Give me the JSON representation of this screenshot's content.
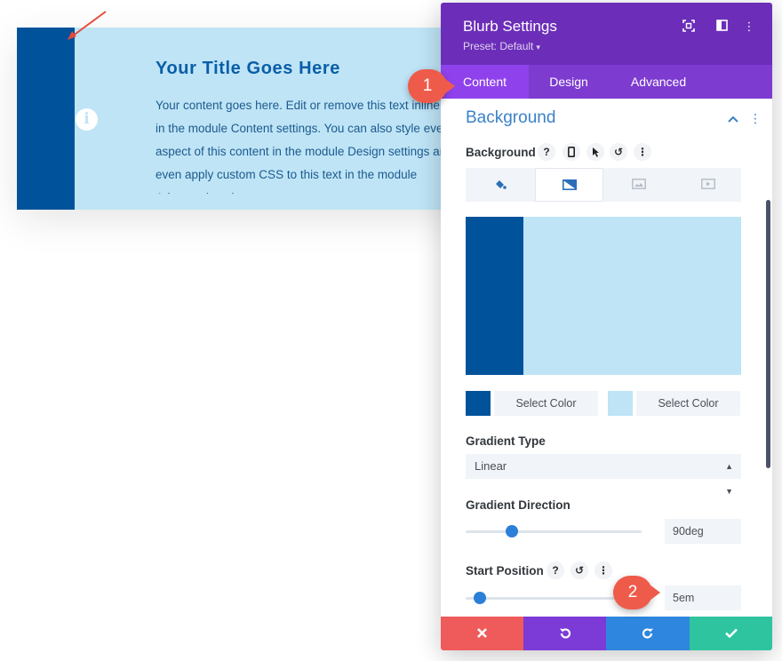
{
  "blurb": {
    "title": "Your Title Goes Here",
    "body": "Your content goes here. Edit or remove this text inline or in the module Content settings. You can also style every aspect of this content in the module Design settings and even apply custom CSS to this text in the module Advanced settings.",
    "icon": "info-icon",
    "colors": {
      "stripe": "#00539b",
      "background": "#bee4f6"
    }
  },
  "panel": {
    "title": "Blurb Settings",
    "preset": "Preset: Default",
    "header_icons": [
      "expand-icon",
      "split-view-icon",
      "more-icon"
    ],
    "tabs": [
      {
        "label": "Content",
        "active": true
      },
      {
        "label": "Design",
        "active": false
      },
      {
        "label": "Advanced",
        "active": false
      }
    ],
    "section": {
      "title": "Background",
      "background_label": "Background",
      "bg_type_tabs": [
        "color-icon",
        "gradient-icon",
        "image-icon",
        "video-icon"
      ],
      "color_stops": [
        {
          "color": "#00539b",
          "label": "Select Color"
        },
        {
          "color": "#bee4f6",
          "label": "Select Color"
        }
      ],
      "gradient_type": {
        "label": "Gradient Type",
        "value": "Linear"
      },
      "gradient_direction": {
        "label": "Gradient Direction",
        "value": "90deg",
        "level": 0.17
      },
      "start_position": {
        "label": "Start Position",
        "value": "5em",
        "level": 0.05
      }
    },
    "footer": {
      "buttons": [
        {
          "name": "cancel",
          "icon": "close-icon",
          "color": "#ef5b5b"
        },
        {
          "name": "undo",
          "icon": "undo-icon",
          "color": "#7c3ad6"
        },
        {
          "name": "redo",
          "icon": "redo-icon",
          "color": "#2e86de"
        },
        {
          "name": "save",
          "icon": "check-icon",
          "color": "#2ec4a0"
        }
      ]
    }
  },
  "annotations": [
    "1",
    "2"
  ],
  "accent_colors": {
    "header": "#6c2eb9",
    "tabs": "#7d3bd0",
    "badge": "#ef5b4a",
    "arrow": "#e8493a"
  }
}
